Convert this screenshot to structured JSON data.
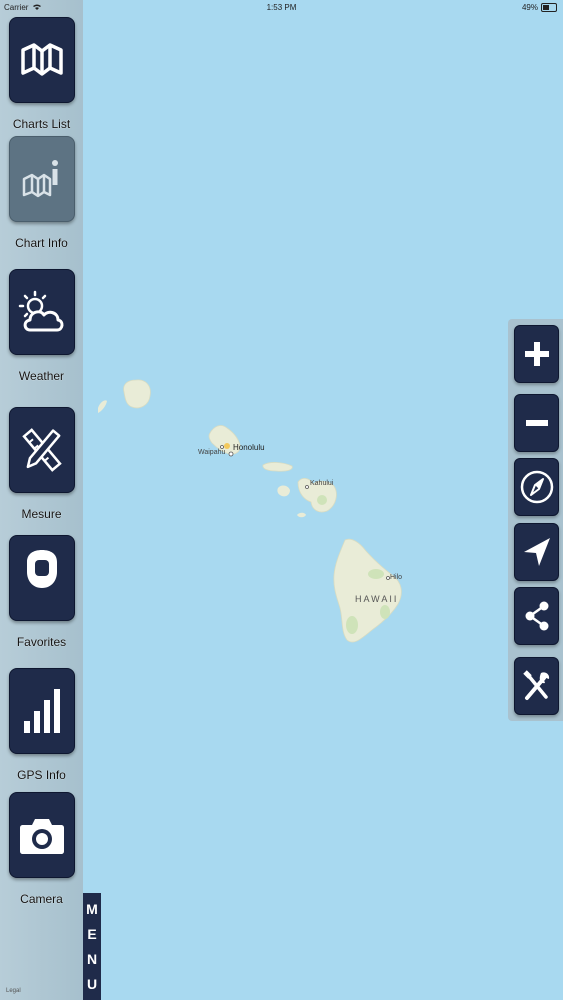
{
  "status_bar": {
    "carrier": "Carrier",
    "time": "1:53 PM",
    "battery": "49%"
  },
  "sidebar": {
    "items": [
      {
        "label": "Charts List",
        "icon": "map-icon"
      },
      {
        "label": "Chart Info",
        "icon": "map-info-icon"
      },
      {
        "label": "Weather",
        "icon": "weather-icon"
      },
      {
        "label": "Mesure",
        "icon": "ruler-pencil-icon"
      },
      {
        "label": "Favorites",
        "icon": "pin-icon"
      },
      {
        "label": "GPS Info",
        "icon": "signal-bars-icon"
      },
      {
        "label": "Camera",
        "icon": "camera-icon"
      }
    ],
    "menu_letters": [
      "M",
      "E",
      "N",
      "U"
    ]
  },
  "map": {
    "labels": {
      "honolulu": "Honolulu",
      "waipahu": "Waipahu",
      "kahului": "Kahului",
      "hilo": "Hilo",
      "hawaii": "HAWAII"
    },
    "legal": "Legal"
  },
  "toolbar": {
    "buttons": [
      {
        "icon": "plus-icon"
      },
      {
        "icon": "minus-icon"
      },
      {
        "icon": "compass-icon"
      },
      {
        "icon": "location-arrow-icon"
      },
      {
        "icon": "share-icon"
      },
      {
        "icon": "tools-icon"
      }
    ]
  }
}
